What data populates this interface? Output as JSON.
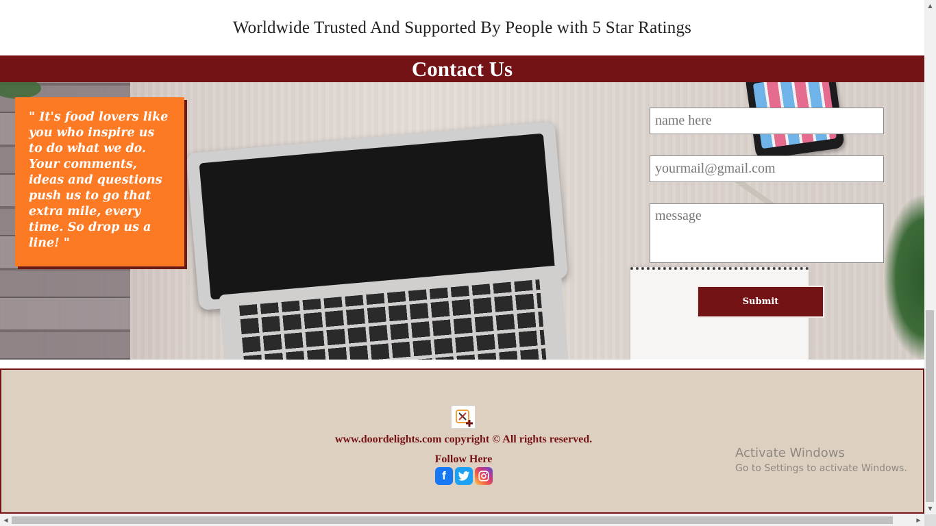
{
  "tagline": "Worldwide Trusted And Supported By People with 5 Star Ratings",
  "contact": {
    "heading": "Contact Us",
    "quote": "\" It's food lovers like you who inspire us to do what we do. Your comments, ideas and questions push us to go that extra mile, every time. So drop us a line! \"",
    "form": {
      "name_placeholder": "name here",
      "email_placeholder": "yourmail@gmail.com",
      "message_placeholder": "message",
      "submit_label": "Submit"
    }
  },
  "footer": {
    "logo_icon": "restaurant-logo-icon",
    "copyright": "www.doordelights.com copyright © All rights reserved.",
    "follow_label": "Follow Here",
    "socials": [
      {
        "name": "facebook-icon",
        "glyph": "f",
        "color": "#1877f2"
      },
      {
        "name": "twitter-icon",
        "glyph": "t",
        "color": "#1da1f2"
      },
      {
        "name": "instagram-icon",
        "glyph": "◎",
        "color": "#c13584"
      }
    ]
  },
  "watermark": {
    "title": "Activate Windows",
    "subtitle": "Go to Settings to activate Windows."
  },
  "colors": {
    "brand": "#741315",
    "accent": "#fd7a25",
    "footer_bg": "#ddd0c0"
  },
  "scrollbars": {
    "vertical_thumb_position": 0.6,
    "horizontal_thumb_position": 0
  }
}
